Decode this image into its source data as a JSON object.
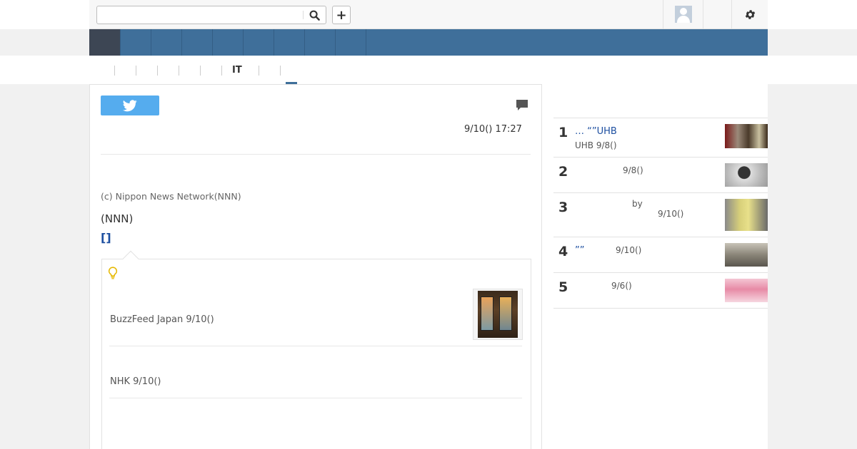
{
  "header": {
    "search": {
      "value": "",
      "placeholder": ""
    },
    "search_icon": "search-icon",
    "add_label": "+",
    "avatar_icon": "user-avatar-icon",
    "settings_icon": "gear-icon"
  },
  "nav": {
    "item_count": 9,
    "colors": {
      "bar": "#3f6f9a",
      "active": "#3d4654"
    }
  },
  "subnav": {
    "label": "IT"
  },
  "article": {
    "share_icon": "twitter-icon",
    "comment_icon": "comment-icon",
    "date": "9/10() 17:27",
    "credit": "(c) Nippon News Network(NNN)",
    "source": "(NNN)",
    "more_link": "[]",
    "related": {
      "icon": "lightbulb-icon",
      "items": [
        {
          "text": "BuzzFeed Japan 9/10()"
        },
        {
          "text": "NHK 9/10()"
        }
      ]
    }
  },
  "ranking": {
    "items": [
      {
        "rank": "1",
        "title": "…  “”UHB",
        "meta": "UHB   9/8()"
      },
      {
        "rank": "2",
        "title": "",
        "meta": "9/8()"
      },
      {
        "rank": "3",
        "title": "",
        "meta_by": "by",
        "meta": "9/10()"
      },
      {
        "rank": "4",
        "title": "”” ",
        "meta": "9/10()"
      },
      {
        "rank": "5",
        "title": "",
        "meta": "9/6()"
      }
    ]
  }
}
